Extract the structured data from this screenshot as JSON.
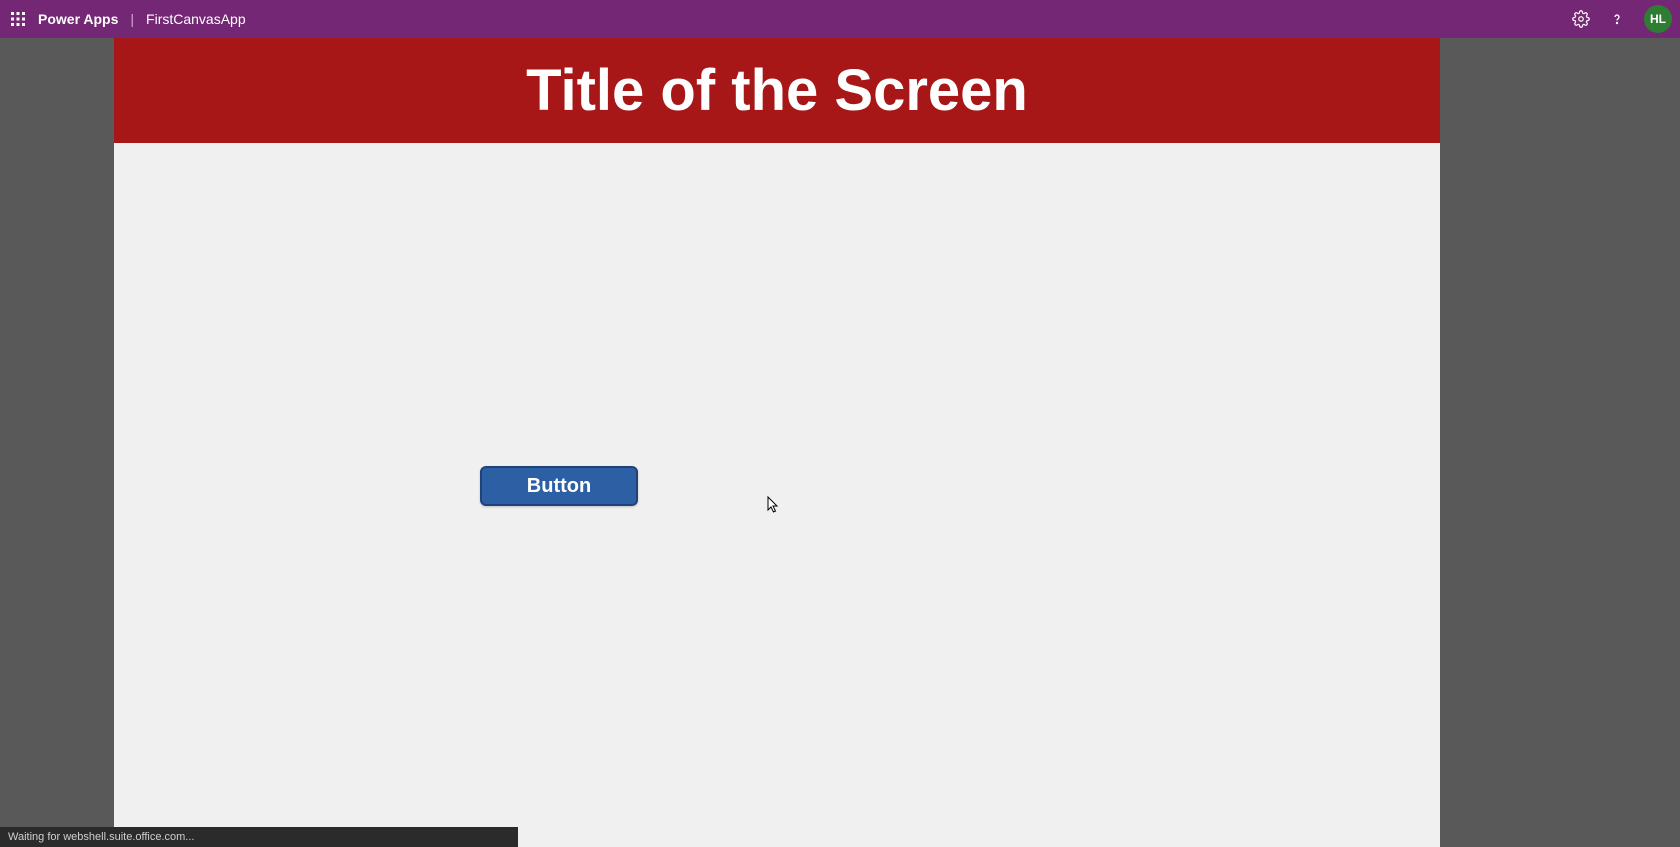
{
  "header": {
    "brand": "Power Apps",
    "divider": "|",
    "app_name": "FirstCanvasApp",
    "avatar_initials": "HL"
  },
  "screen": {
    "title": "Title of the Screen",
    "button_label": "Button"
  },
  "status": {
    "text": "Waiting for webshell.suite.office.com..."
  }
}
